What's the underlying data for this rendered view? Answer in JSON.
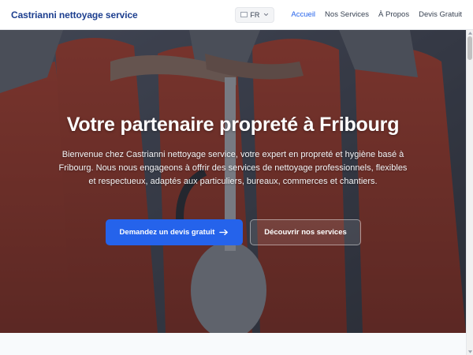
{
  "header": {
    "brand": "Castrianni nettoyage service",
    "language": {
      "code": "FR",
      "flag_icon": "swiss-flag-icon",
      "chevron_icon": "chevron-down-icon"
    },
    "nav": [
      {
        "label": "Accueil",
        "active": true
      },
      {
        "label": "Nos Services",
        "active": false
      },
      {
        "label": "À Propos",
        "active": false
      },
      {
        "label": "Devis Gratuit",
        "active": false
      }
    ]
  },
  "hero": {
    "title": "Votre partenaire propreté à Fribourg",
    "description": "Bienvenue chez Castrianni nettoyage service, votre expert en propreté et hygiène basé à Fribourg. Nous nous engageons à offrir des services de nettoyage professionnels, flexibles et respectueux, adaptés aux particuliers, bureaux, commerces et chantiers.",
    "primary_button": {
      "label": "Demandez un devis gratuit",
      "icon": "arrow-right-icon"
    },
    "secondary_button": {
      "label": "Découvrir nos services"
    },
    "background": "cleaning-team-in-red-uniforms-photo"
  },
  "colors": {
    "brand": "#1d3f8f",
    "accent": "#2563eb",
    "hero_overlay": "#1c202a"
  }
}
